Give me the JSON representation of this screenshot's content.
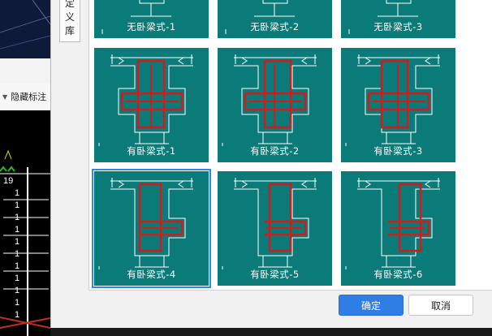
{
  "background": {
    "toolbar_label": "隐藏标注",
    "drawing_labels": [
      "19",
      "1",
      "1",
      "1",
      "1",
      "1",
      "1",
      "1",
      "1",
      "1",
      "1",
      "1"
    ]
  },
  "dialog": {
    "side_tab_chars": [
      "定",
      "义",
      "库"
    ],
    "options": [
      {
        "label": "无卧梁式-1",
        "style": "none",
        "selected": false
      },
      {
        "label": "无卧梁式-2",
        "style": "none",
        "selected": false
      },
      {
        "label": "无卧梁式-3",
        "style": "none",
        "selected": false
      },
      {
        "label": "有卧梁式-1",
        "style": "cross",
        "selected": false
      },
      {
        "label": "有卧梁式-2",
        "style": "cross",
        "selected": false
      },
      {
        "label": "有卧梁式-3",
        "style": "cross",
        "selected": false
      },
      {
        "label": "有卧梁式-4",
        "style": "side",
        "selected": true
      },
      {
        "label": "有卧梁式-5",
        "style": "side",
        "selected": false
      },
      {
        "label": "有卧梁式-6",
        "style": "side",
        "selected": false
      }
    ],
    "ok_label": "确定",
    "cancel_label": "取消"
  },
  "colors": {
    "tile": "#0a7b78",
    "rebar": "#d11c1c",
    "accent": "#2f7ee6"
  }
}
